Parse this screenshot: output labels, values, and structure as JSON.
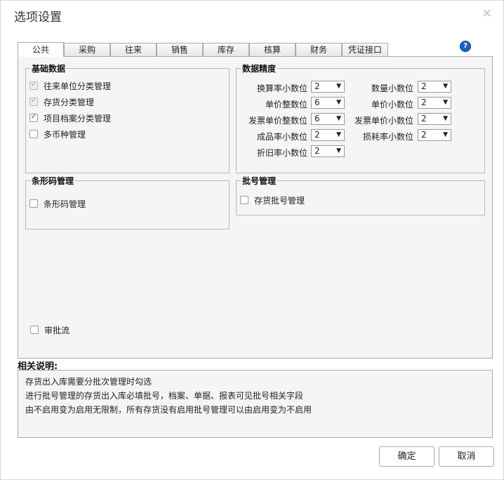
{
  "dialog": {
    "title": "选项设置",
    "close_icon": "×"
  },
  "tabs": [
    {
      "label": "公共",
      "active": true
    },
    {
      "label": "采购"
    },
    {
      "label": "往来"
    },
    {
      "label": "销售"
    },
    {
      "label": "库存"
    },
    {
      "label": "核算"
    },
    {
      "label": "财务"
    },
    {
      "label": "凭证接口"
    }
  ],
  "help_icon": "?",
  "basic_data": {
    "legend": "基础数据",
    "items": [
      {
        "label": "往来单位分类管理",
        "checked": true,
        "disabled": true
      },
      {
        "label": "存货分类管理",
        "checked": true,
        "disabled": true
      },
      {
        "label": "项目档案分类管理",
        "checked": true,
        "disabled": false
      },
      {
        "label": "多币种管理",
        "checked": false,
        "disabled": false
      }
    ]
  },
  "precision": {
    "legend": "数据精度",
    "left": [
      {
        "label": "换算率小数位",
        "value": "2"
      },
      {
        "label": "单价整数位",
        "value": "6"
      },
      {
        "label": "发票单价整数位",
        "value": "6"
      },
      {
        "label": "成品率小数位",
        "value": "2"
      },
      {
        "label": "折旧率小数位",
        "value": "2"
      }
    ],
    "right": [
      {
        "label": "数量小数位",
        "value": "2"
      },
      {
        "label": "单价小数位",
        "value": "2"
      },
      {
        "label": "发票单价小数位",
        "value": "2"
      },
      {
        "label": "损耗率小数位",
        "value": "2"
      }
    ]
  },
  "barcode": {
    "legend": "条形码管理",
    "item": "条形码管理"
  },
  "batch": {
    "legend": "批号管理",
    "item": "存货批号管理"
  },
  "approval": {
    "label": "审批流"
  },
  "description": {
    "title": "相关说明:",
    "lines": [
      "存货出入库需要分批次管理时勾选",
      "进行批号管理的存货出入库必填批号，档案、单据、报表可见批号相关字段",
      "由不启用变为启用无限制，所有存货没有启用批号管理可以由启用变为不启用"
    ]
  },
  "buttons": {
    "confirm": "确定",
    "cancel": "取消"
  }
}
